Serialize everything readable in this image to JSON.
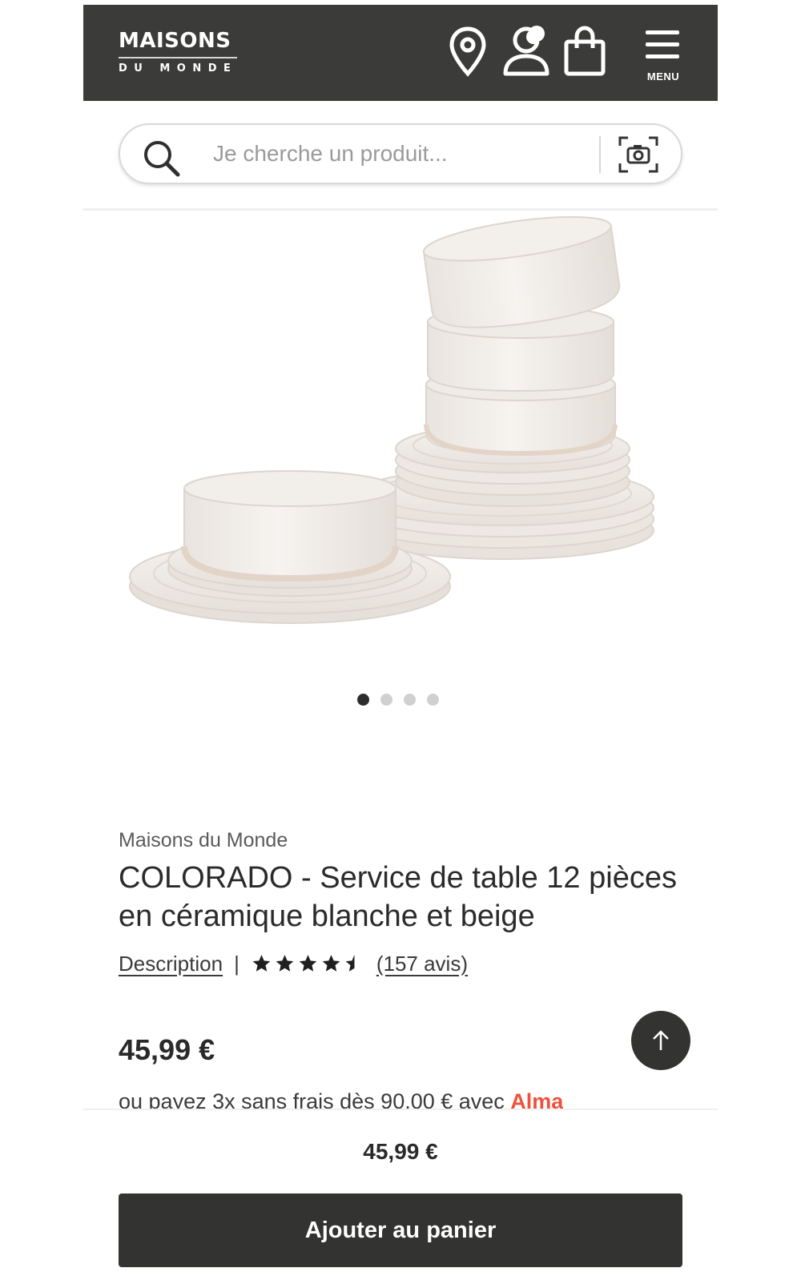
{
  "header": {
    "logo_main": "MAISONS",
    "logo_sub": "DU MONDE",
    "menu_label": "MENU",
    "icons": [
      "location-pin-icon",
      "account-icon",
      "shopping-bag-icon",
      "hamburger-menu-icon"
    ]
  },
  "search": {
    "placeholder": "Je cherche un produit...",
    "value": "",
    "icons": [
      "search-icon",
      "camera-icon"
    ]
  },
  "gallery": {
    "image_count": 4,
    "active_index": 0
  },
  "product": {
    "brand": "Maisons du Monde",
    "title": "COLORADO - Service de table 12 pièces en céramique blanche et beige",
    "description_link": "Description",
    "separator": "|",
    "rating": 4.5,
    "rating_max": 5,
    "reviews_label": "(157 avis)",
    "price": "45,99 €",
    "installment_text": "ou payez 3x sans frais dès 90,00 € avec ",
    "installment_provider": "Alma"
  },
  "sticky": {
    "price": "45,99 €",
    "add_to_cart_label": "Ajouter au panier"
  },
  "colors": {
    "header_bg": "#3b3b39",
    "button_bg": "#333331",
    "alma": "#f0503c",
    "dishware": "#f2eeea"
  }
}
